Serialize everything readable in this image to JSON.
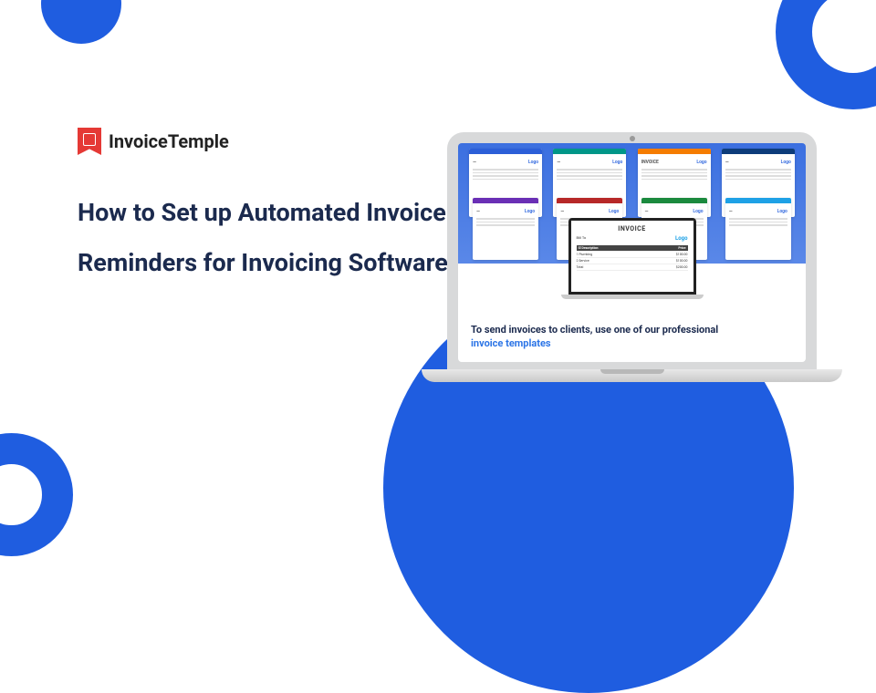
{
  "brand": {
    "name": "InvoiceTemple"
  },
  "headline": "How to Set up Automated Invoice Reminders for Invoicing Software?",
  "laptop": {
    "caption_line1": "To send invoices to clients, use one of our professional",
    "caption_line2": "invoice templates",
    "template_logo_text": "Logo",
    "invoice_word": "INVOICE"
  },
  "colors": {
    "primary": "#1f5de0",
    "accent_red": "#e53935",
    "text_dark": "#1b2a4e",
    "link_blue": "#2b74e6"
  }
}
